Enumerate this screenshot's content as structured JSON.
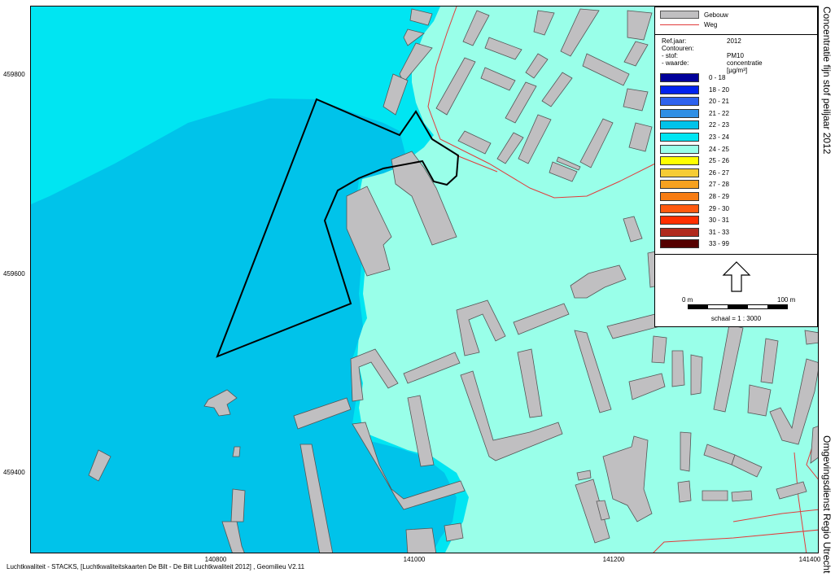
{
  "title": "Concentratie fijn stof peiljaar 2012",
  "organization": "Omgevingsdienst Regio Utrecht",
  "footer": "Luchtkwaliteit - STACKS, [Luchtkwaliteitskaarten De Bilt - De Bilt Luchtkwaliteit 2012] , Geomilieu V2.11",
  "axes": {
    "y_ticks": [
      "459800",
      "459600",
      "459400"
    ],
    "x_ticks": [
      "140800",
      "141000",
      "141200",
      "141400"
    ]
  },
  "legend": {
    "layers": [
      {
        "label": "Gebouw",
        "type": "fill",
        "color": "#c0bfc1"
      },
      {
        "label": "Weg",
        "type": "line",
        "color": "#e23b3b"
      }
    ],
    "meta": {
      "ref_label": "Ref.jaar:",
      "ref_value": "2012",
      "contours_label": "Contouren:",
      "stof_label": "- stof:",
      "stof_value": "PM10",
      "waarde_label": "- waarde:",
      "waarde_value": "concentratie [µg/m³]"
    },
    "classes": [
      {
        "label": "0 - 18",
        "color": "#00009a"
      },
      {
        "label": "18 - 20",
        "color": "#0022ee"
      },
      {
        "label": "20 - 21",
        "color": "#2e62ee"
      },
      {
        "label": "21 - 22",
        "color": "#2f8fe5"
      },
      {
        "label": "22 - 23",
        "color": "#00c3ea"
      },
      {
        "label": "23 - 24",
        "color": "#00e5f2"
      },
      {
        "label": "24 - 25",
        "color": "#99ffe9"
      },
      {
        "label": "25 - 26",
        "color": "#ffff00"
      },
      {
        "label": "26 - 27",
        "color": "#f6cc35"
      },
      {
        "label": "27 - 28",
        "color": "#f7a11f"
      },
      {
        "label": "28 - 29",
        "color": "#f77c12"
      },
      {
        "label": "29 - 30",
        "color": "#ff5a10"
      },
      {
        "label": "30 - 31",
        "color": "#ff2e00"
      },
      {
        "label": "31 - 33",
        "color": "#b02a1e"
      },
      {
        "label": "33 - 99",
        "color": "#550000"
      }
    ],
    "scale": {
      "start": "0 m",
      "end": "100 m",
      "text": "schaal = 1 : 3000"
    }
  },
  "colors": {
    "zone_22_23": "#00c3ea",
    "zone_23_24": "#00e5f2",
    "zone_24_25": "#99ffe9",
    "building": "#c0bfc1",
    "building_stroke": "#555555",
    "road": "#e23b3b",
    "plan_outline": "#000000"
  }
}
